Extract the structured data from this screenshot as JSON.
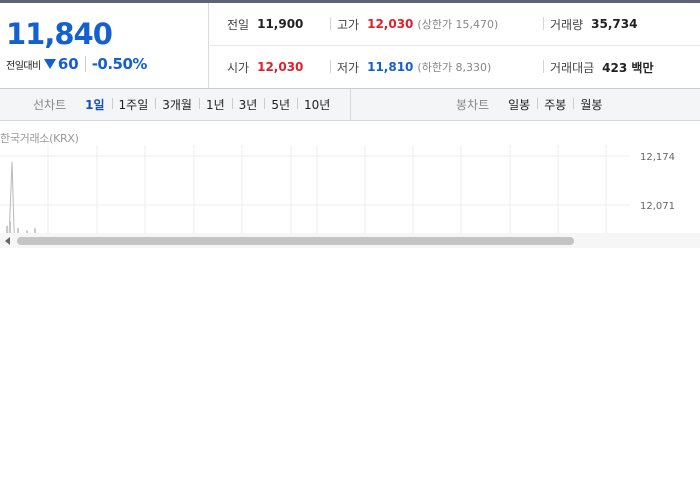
{
  "quote": {
    "price": "11,840",
    "change_label": "전일대비",
    "change_value": "60",
    "change_percent": "-0.50%",
    "direction": "down",
    "colors": {
      "up": "#e0202a",
      "down": "#1560d0"
    }
  },
  "info": {
    "prev_close": {
      "label": "전일",
      "value": "11,900"
    },
    "high": {
      "label": "고가",
      "value": "12,030",
      "sub_label": "(상한가 15,470)"
    },
    "volume": {
      "label": "거래량",
      "value": "35,734"
    },
    "open": {
      "label": "시가",
      "value": "12,030"
    },
    "low": {
      "label": "저가",
      "value": "11,810",
      "sub_label": "(하한가 8,330)"
    },
    "trade_amount": {
      "label": "거래대금",
      "value": "423 백만"
    }
  },
  "toolbar": {
    "line_chart_label": "선차트",
    "periods": [
      "1일",
      "1주일",
      "3개월",
      "1년",
      "3년",
      "5년",
      "10년"
    ],
    "active_period": "1일",
    "candle_chart_label": "봉차트",
    "candles": [
      "일봉",
      "주봉",
      "월봉"
    ]
  },
  "chart": {
    "source": "한국거래소(KRX)",
    "icons": [
      "scroll-left-arrow-icon"
    ]
  },
  "chart_data": {
    "type": "line",
    "title": "",
    "xlabel": "",
    "ylabel": "",
    "y_tick_labels": [
      "12,174",
      "12,071"
    ],
    "y_ticks": [
      12174,
      12071
    ],
    "series": [
      {
        "values": [
          11940,
          11945,
          12162,
          11955,
          11946,
          11944
        ]
      }
    ],
    "volume_bars": [
      3,
      5,
      2,
      1,
      2
    ],
    "grid": true
  }
}
